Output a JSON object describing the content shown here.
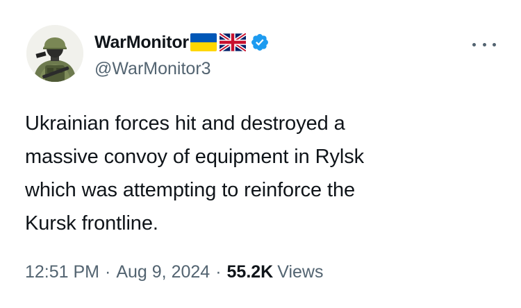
{
  "author": {
    "display_name": "WarMonitor",
    "handle": "@WarMonitor3",
    "avatar_icon": "soldier-avatar",
    "flags": [
      "ukraine-flag-icon",
      "uk-flag-icon"
    ],
    "verified_icon": "verified-badge-icon"
  },
  "tweet": {
    "text": "Ukrainian forces hit and destroyed a\nmassive convoy of equipment in Rylsk\nwhich was attempting to reinforce the\nKursk frontline."
  },
  "meta": {
    "time": "12:51 PM",
    "separator": "·",
    "date": "Aug 9, 2024",
    "views_count": "55.2K",
    "views_label": "Views"
  },
  "colors": {
    "text_primary": "#0f1419",
    "text_secondary": "#536471",
    "verified_blue": "#1d9bf0",
    "ukraine_blue": "#0057b7",
    "ukraine_yellow": "#ffd700"
  }
}
